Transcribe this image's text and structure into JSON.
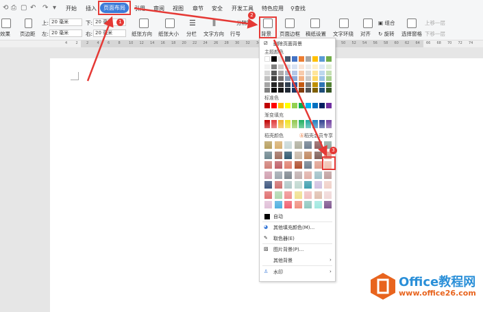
{
  "tabs": [
    "开始",
    "插入",
    "页面布局",
    "引用",
    "审阅",
    "视图",
    "章节",
    "安全",
    "开发工具",
    "特色应用"
  ],
  "active_tab": "页面布局",
  "search_label": "查找",
  "toolbar": {
    "effects": "效果",
    "margins": "页边距",
    "top_label": "上:",
    "top_value": "20 毫米",
    "bottom_label": "下:",
    "bottom_value": "20 毫米",
    "left_label": "左:",
    "left_value": "20 毫米",
    "right_label": "右:",
    "right_value": "20 毫米",
    "orientation": "纸张方向",
    "size": "纸张大小",
    "columns": "分栏",
    "text_direction": "文字方向",
    "line_numbers": "行号",
    "separator": "分隔符",
    "background": "背景",
    "page_border": "页面边框",
    "paper_setup": "稿纸设置",
    "text_wrap": "文字环绕",
    "align": "对齐",
    "group": "组合",
    "rotate": "旋转",
    "select_pane": "选择窗格",
    "bring_forward": "上移一层",
    "send_backward": "下移一层"
  },
  "ruler_ticks": [
    "4",
    "2",
    "2",
    "4",
    "6",
    "8",
    "10",
    "12",
    "14",
    "16",
    "18",
    "20",
    "22",
    "24",
    "26",
    "28",
    "30",
    "32",
    "34",
    "36",
    "38",
    "40",
    "42",
    "44",
    "46",
    "48",
    "50",
    "52",
    "54",
    "56",
    "58",
    "60",
    "62",
    "64",
    "66",
    "68",
    "70",
    "72",
    "74"
  ],
  "menu": {
    "remove_bg": "删除页面背景",
    "theme_colors": "主题颜色",
    "standard_colors": "标准色",
    "gradient_fill": "渐变填充",
    "texture_colors": "稻壳颜色",
    "texture_exclusive": "稻壳会员专享",
    "auto": "自动",
    "more_fill": "其他填充颜色(M)...",
    "eyedropper": "取色器(E)",
    "picture_bg": "图片背景(P)...",
    "other_bg": "其他背景",
    "watermark": "水印",
    "theme_base": [
      "#ffffff",
      "#000000",
      "#e7e6e6",
      "#44546a",
      "#4472c4",
      "#ed7d31",
      "#a5a5a5",
      "#ffc000",
      "#5b9bd5",
      "#70ad47"
    ],
    "theme_shades": [
      [
        "#f2f2f2",
        "#7f7f7f",
        "#d0cece",
        "#d6dce4",
        "#d9e2f3",
        "#fbe5d5",
        "#ededed",
        "#fff2cc",
        "#deeaf6",
        "#e2efd9"
      ],
      [
        "#d8d8d8",
        "#595959",
        "#aeabab",
        "#adb9ca",
        "#b4c6e7",
        "#f7cbac",
        "#dbdbdb",
        "#ffe599",
        "#bdd7ee",
        "#c5e0b3"
      ],
      [
        "#bfbfbf",
        "#3f3f3f",
        "#757070",
        "#8496b0",
        "#8eaadb",
        "#f4b183",
        "#c9c9c9",
        "#ffd965",
        "#9cc3e5",
        "#a8d08d"
      ],
      [
        "#a5a5a5",
        "#262626",
        "#3a3838",
        "#323f4f",
        "#2f5496",
        "#c55a11",
        "#7b7b7b",
        "#bf9000",
        "#2e75b5",
        "#538135"
      ],
      [
        "#7f7f7f",
        "#0c0c0c",
        "#171616",
        "#222a35",
        "#1f3864",
        "#833c0b",
        "#525252",
        "#7f6000",
        "#1e4e79",
        "#375623"
      ]
    ],
    "standard": [
      "#c00000",
      "#ff0000",
      "#ffc000",
      "#ffff00",
      "#92d050",
      "#00b050",
      "#00b0f0",
      "#0070c0",
      "#002060",
      "#7030a0"
    ],
    "gradient": [
      "#c00000",
      "#e03a3a",
      "#f0b030",
      "#f0e020",
      "#90c850",
      "#20b060",
      "#20a8a0",
      "#2080c0",
      "#304090",
      "#7040a0"
    ],
    "texture": [
      [
        "#b8a060",
        "#d8b070",
        "#c8d8d8",
        "#b0b0a0",
        "#708090",
        "#906060",
        "#90a8a0"
      ],
      [
        "#708890",
        "#a07060",
        "#305870",
        "#c8b8a8",
        "#c08860",
        "#806058",
        "#e09080"
      ],
      [
        "#d08078",
        "#c06068",
        "#e08070",
        "#b05030",
        "#708090",
        "#e0a090",
        "#f0c0b0"
      ],
      [
        "#d0a0b0",
        "#a0a8b0",
        "#808890",
        "#c0b0b0",
        "#e0b0a8",
        "#a0c0c8",
        "#c0a0a0"
      ],
      [
        "#405880",
        "#d07070",
        "#b0c8c8",
        "#c0d8d0",
        "#40a0b0",
        "#d0c0e0",
        "#f0d0c8"
      ],
      [
        "#e07070",
        "#b0d8b0",
        "#f09090",
        "#f0e090",
        "#f0c0c0",
        "#e0c0b0",
        "#f0d8d8"
      ],
      [
        "#e0c0d8",
        "#50b0e0",
        "#f06070",
        "#f09080",
        "#90c8c0",
        "#a0e8e0",
        "#805890"
      ]
    ]
  },
  "watermark_logo": {
    "brand": "Office教程网",
    "url": "www.office26.com",
    "color": "#e8641e"
  },
  "annotations": [
    "1",
    "2",
    "3"
  ],
  "accent": "#3c7bd8"
}
